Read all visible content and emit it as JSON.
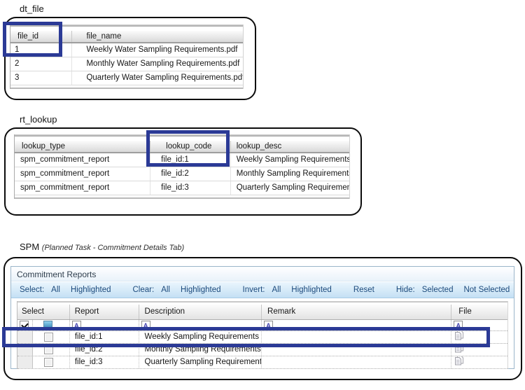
{
  "annotation": {
    "color": "#2b3a96"
  },
  "dt_file": {
    "label": "dt_file",
    "columns": [
      "file_id",
      "file_name"
    ],
    "rows": [
      {
        "file_id": "1",
        "file_name": "Weekly Water Sampling Requirements.pdf"
      },
      {
        "file_id": "2",
        "file_name": "Monthly Water Sampling Requirements.pdf"
      },
      {
        "file_id": "3",
        "file_name": "Quarterly Water Sampling Requirements.pdf"
      }
    ]
  },
  "rt_lookup": {
    "label": "rt_lookup",
    "columns": [
      "lookup_type",
      "lookup_code",
      "lookup_desc"
    ],
    "rows": [
      {
        "lookup_type": "spm_commitment_report",
        "lookup_code": "file_id:1",
        "lookup_desc": "Weekly Sampling Requirements"
      },
      {
        "lookup_type": "spm_commitment_report",
        "lookup_code": "file_id:2",
        "lookup_desc": "Monthly Sampling Requirements"
      },
      {
        "lookup_type": "spm_commitment_report",
        "lookup_code": "file_id:3",
        "lookup_desc": "Quarterly Sampling Requirements"
      }
    ]
  },
  "spm": {
    "label": "SPM",
    "sublabel": "(Planned Task - Commitment Details Tab)",
    "panel_title": "Commitment Reports",
    "toolbar": {
      "items": [
        {
          "kind": "label",
          "text": "Select:"
        },
        {
          "kind": "action",
          "text": "All"
        },
        {
          "kind": "action",
          "text": "Highlighted"
        },
        {
          "kind": "separator"
        },
        {
          "kind": "label",
          "text": "Clear:"
        },
        {
          "kind": "action",
          "text": "All"
        },
        {
          "kind": "action",
          "text": "Highlighted"
        },
        {
          "kind": "separator"
        },
        {
          "kind": "label",
          "text": "Invert:"
        },
        {
          "kind": "action",
          "text": "All"
        },
        {
          "kind": "action",
          "text": "Highlighted"
        },
        {
          "kind": "separator"
        },
        {
          "kind": "action",
          "text": "Reset"
        },
        {
          "kind": "separator"
        },
        {
          "kind": "label",
          "text": "Hide:"
        },
        {
          "kind": "action",
          "text": "Selected"
        },
        {
          "kind": "action",
          "text": "Not Selected"
        }
      ]
    },
    "grid": {
      "columns": [
        "Select",
        "Report",
        "Description",
        "Remark",
        "File"
      ],
      "filter_letter": "A",
      "rows": [
        {
          "report": "file_id:1",
          "description": "Weekly Sampling Requirements",
          "remark": "",
          "checked": false,
          "file_icon": "document-copy-icon"
        },
        {
          "report": "file_id:2",
          "description": "Monthly Sampling Requirements",
          "remark": "",
          "checked": false,
          "file_icon": "document-copy-icon"
        },
        {
          "report": "file_id:3",
          "description": "Quarterly Sampling Requirements",
          "remark": "",
          "checked": false,
          "file_icon": "document-copy-icon"
        }
      ]
    }
  }
}
